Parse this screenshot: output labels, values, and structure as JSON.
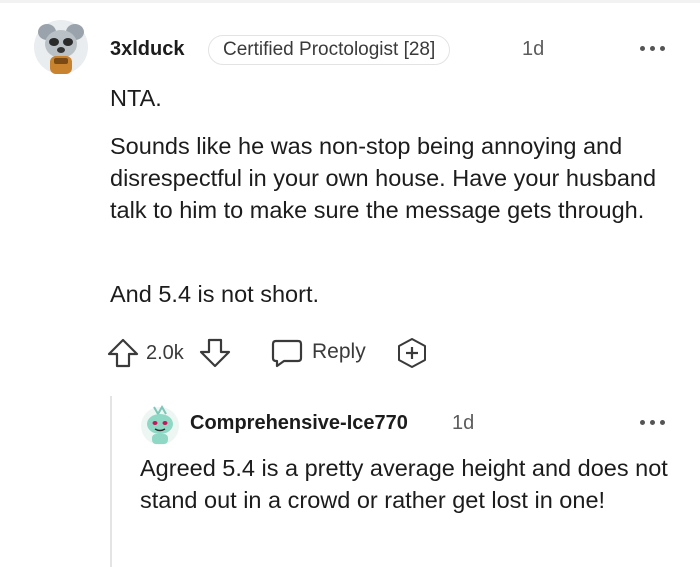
{
  "comment": {
    "username": "3xlduck",
    "flair": "Certified Proctologist [28]",
    "time": "1d",
    "paragraphs": [
      "NTA.",
      "Sounds like he was non-stop being annoying and disrespectful in your own house. Have your husband talk to him to make sure the message gets through.",
      "And 5.4 is not short."
    ],
    "score": "2.0k",
    "reply_label": "Reply",
    "icons": [
      "overflow-menu-icon",
      "upvote-icon",
      "downvote-icon",
      "comment-bubble-icon",
      "award-plus-icon"
    ]
  },
  "reply": {
    "username": "Comprehensive-Ice770",
    "time": "1d",
    "text": "Agreed 5.4 is a pretty average height and does not stand out in a crowd or rather get lost in one!"
  }
}
